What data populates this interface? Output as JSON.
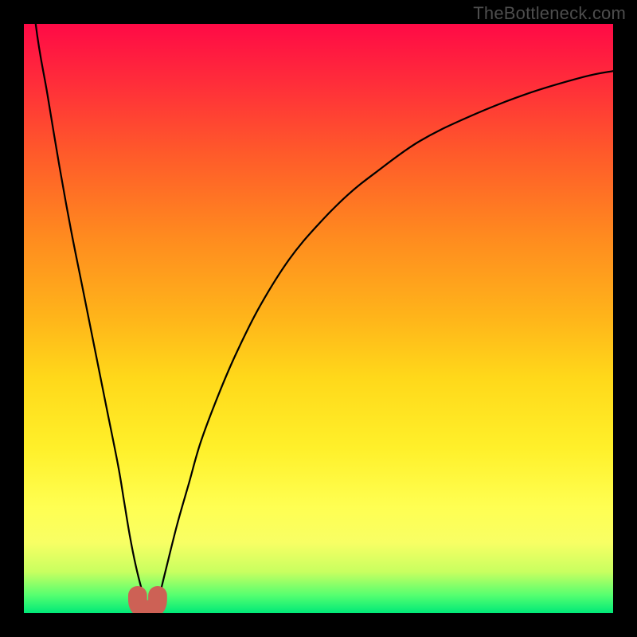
{
  "watermark": {
    "text": "TheBottleneck.com"
  },
  "chart_data": {
    "type": "line",
    "title": "",
    "xlabel": "",
    "ylabel": "",
    "xlim": [
      0,
      100
    ],
    "ylim": [
      0,
      100
    ],
    "grid": false,
    "legend": false,
    "notes": "Gradient background: red at top (bottleneck ~100%) to green at bottom (0%). Black curve shows bottleneck percentage vs relative component strength; minimum near x≈21. Salmon U-shaped marker highlights the optimal region at the bottom.",
    "series": [
      {
        "name": "bottleneck-curve",
        "x": [
          0,
          2,
          4,
          6,
          8,
          10,
          12,
          14,
          16,
          17,
          18,
          19,
          20,
          20.8,
          21.5,
          22.3,
          23,
          24,
          26,
          28,
          30,
          33,
          36,
          40,
          45,
          50,
          55,
          60,
          67,
          75,
          85,
          95,
          100
        ],
        "values": [
          120,
          100,
          88,
          76,
          65,
          55,
          45,
          35,
          25,
          19,
          13,
          8,
          4,
          1.5,
          0.4,
          1.0,
          3,
          7,
          15,
          22,
          29,
          37,
          44,
          52,
          60,
          66,
          71,
          75,
          80,
          84,
          88,
          91,
          92
        ]
      }
    ],
    "marker": {
      "name": "optimal-region",
      "x_center": 21,
      "width": 3.4,
      "height": 3.0
    },
    "gradient_stops": [
      {
        "pos": 0.0,
        "color": "#ff0a46"
      },
      {
        "pos": 0.1,
        "color": "#ff2d3a"
      },
      {
        "pos": 0.22,
        "color": "#ff5a2a"
      },
      {
        "pos": 0.36,
        "color": "#ff8a1f"
      },
      {
        "pos": 0.5,
        "color": "#ffb51a"
      },
      {
        "pos": 0.6,
        "color": "#ffd81a"
      },
      {
        "pos": 0.72,
        "color": "#fff02a"
      },
      {
        "pos": 0.82,
        "color": "#ffff52"
      },
      {
        "pos": 0.88,
        "color": "#f8ff64"
      },
      {
        "pos": 0.93,
        "color": "#c8ff60"
      },
      {
        "pos": 0.97,
        "color": "#54ff70"
      },
      {
        "pos": 1.0,
        "color": "#00e878"
      }
    ]
  }
}
